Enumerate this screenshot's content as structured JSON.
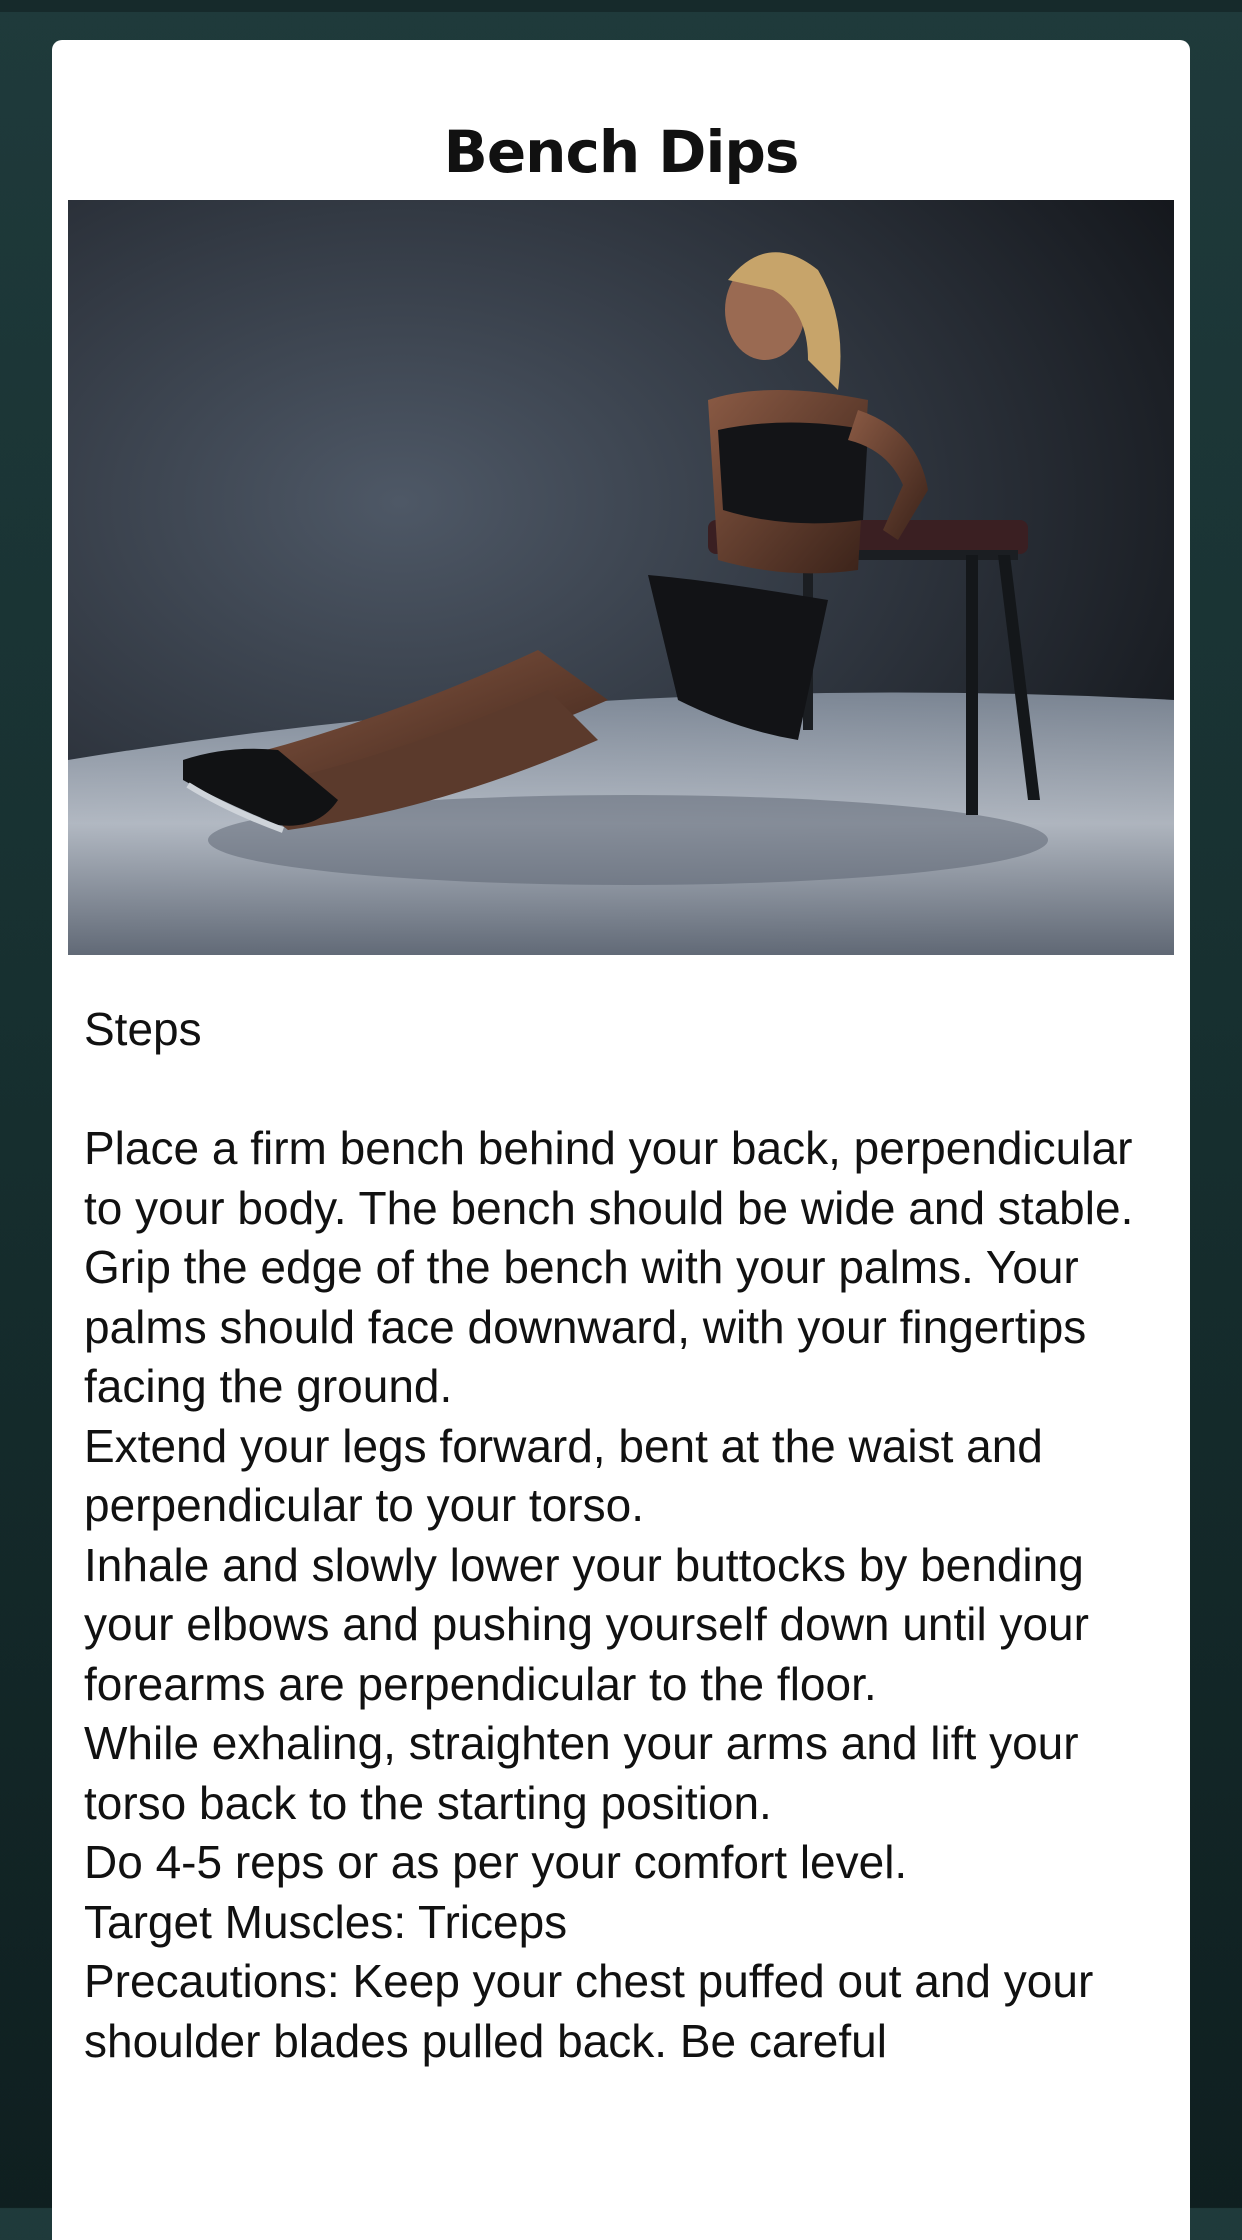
{
  "exercise": {
    "title": "Bench Dips",
    "image": {
      "description_icon": "bench-dips-photo"
    }
  },
  "steps": {
    "heading": "Steps",
    "lines": [
      "Place a firm bench behind your back, perpendicular to your body. The bench should be wide and stable.",
      "Grip the edge of the bench with your palms. Your palms should face downward, with your fingertips facing the ground.",
      "Extend your legs forward, bent at the waist and perpendicular to your torso.",
      "Inhale and slowly lower your buttocks by bending your elbows and pushing yourself down until your forearms are perpendicular to the floor.",
      "While exhaling, straighten your arms and lift your torso back to the starting position.",
      "Do 4-5 reps or as per your comfort level.",
      "Target Muscles: Triceps",
      "Precautions: Keep your chest puffed out and your shoulder blades pulled back. Be careful"
    ]
  },
  "colors": {
    "background_top": "#1f3a3b",
    "background_bottom": "#0f1f20",
    "card": "#ffffff",
    "text": "#111111"
  }
}
